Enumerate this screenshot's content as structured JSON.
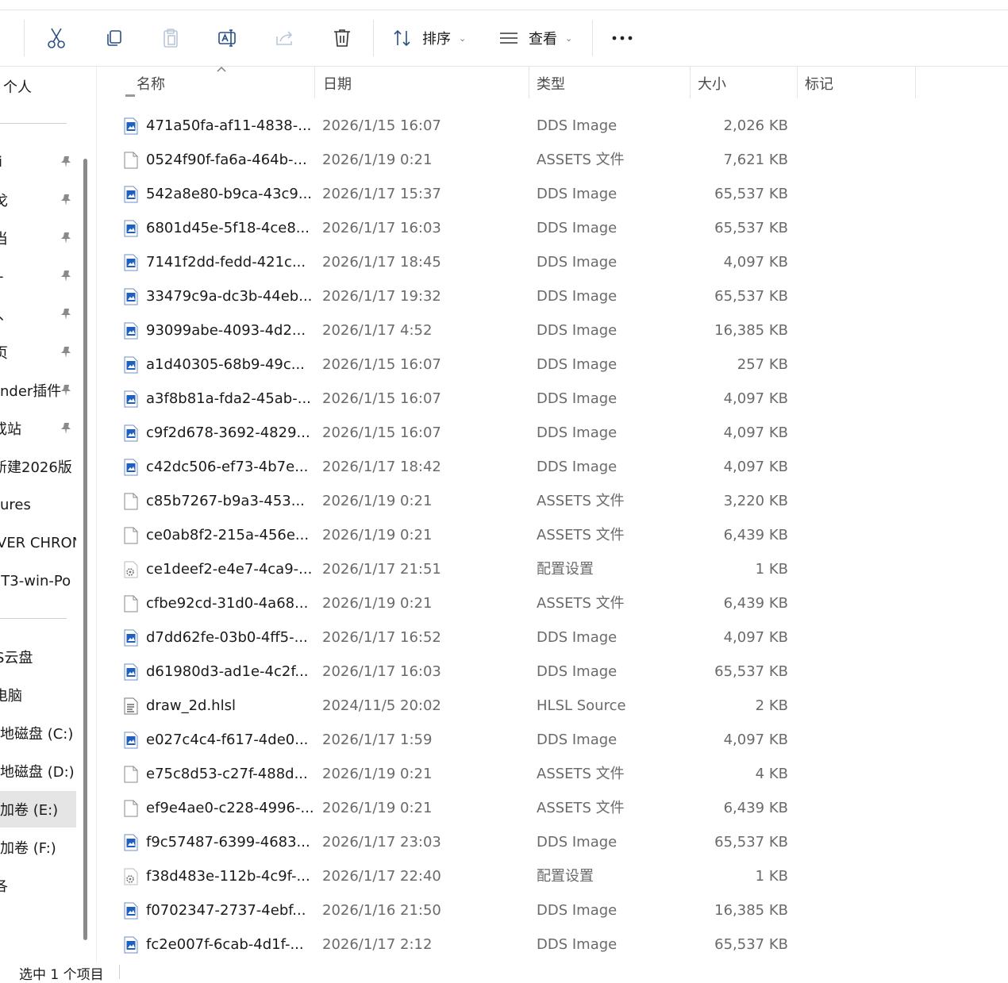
{
  "toolbar": {
    "sort_label": "排序",
    "view_label": "查看"
  },
  "sidebar": {
    "top_item": "个人",
    "pinned": [
      "i",
      "戈",
      "当",
      "-",
      "、",
      "页",
      "nder插件",
      "或站"
    ],
    "items": [
      "新建2026版",
      "ures",
      "VER CHRON",
      "IT3-win-Po"
    ],
    "drives": [
      "S云盘",
      "电脑",
      "地磁盘 (C:)",
      "地磁盘 (D:)",
      "加卷 (E:)",
      "加卷 (F:)",
      "各"
    ]
  },
  "columns": {
    "name": "名称",
    "date": "日期",
    "type": "类型",
    "size": "大小",
    "tags": "标记"
  },
  "files": [
    {
      "name": "471a50fa-af11-4838-...",
      "date": "2026/1/15 16:07",
      "type": "DDS Image",
      "size": "2,026 KB",
      "icon": "image"
    },
    {
      "name": "0524f90f-fa6a-464b-...",
      "date": "2026/1/19 0:21",
      "type": "ASSETS 文件",
      "size": "7,621 KB",
      "icon": "blank"
    },
    {
      "name": "542a8e80-b9ca-43c9...",
      "date": "2026/1/17 15:37",
      "type": "DDS Image",
      "size": "65,537 KB",
      "icon": "image"
    },
    {
      "name": "6801d45e-5f18-4ce8...",
      "date": "2026/1/17 16:03",
      "type": "DDS Image",
      "size": "65,537 KB",
      "icon": "image"
    },
    {
      "name": "7141f2dd-fedd-421c...",
      "date": "2026/1/17 18:45",
      "type": "DDS Image",
      "size": "4,097 KB",
      "icon": "image"
    },
    {
      "name": "33479c9a-dc3b-44eb...",
      "date": "2026/1/17 19:32",
      "type": "DDS Image",
      "size": "65,537 KB",
      "icon": "image"
    },
    {
      "name": "93099abe-4093-4d2...",
      "date": "2026/1/17 4:52",
      "type": "DDS Image",
      "size": "16,385 KB",
      "icon": "image"
    },
    {
      "name": "a1d40305-68b9-49c...",
      "date": "2026/1/15 16:07",
      "type": "DDS Image",
      "size": "257 KB",
      "icon": "image"
    },
    {
      "name": "a3f8b81a-fda2-45ab-...",
      "date": "2026/1/15 16:07",
      "type": "DDS Image",
      "size": "4,097 KB",
      "icon": "image"
    },
    {
      "name": "c9f2d678-3692-4829...",
      "date": "2026/1/15 16:07",
      "type": "DDS Image",
      "size": "4,097 KB",
      "icon": "image"
    },
    {
      "name": "c42dc506-ef73-4b7e...",
      "date": "2026/1/17 18:42",
      "type": "DDS Image",
      "size": "4,097 KB",
      "icon": "image"
    },
    {
      "name": "c85b7267-b9a3-453...",
      "date": "2026/1/19 0:21",
      "type": "ASSETS 文件",
      "size": "3,220 KB",
      "icon": "blank"
    },
    {
      "name": "ce0ab8f2-215a-456e...",
      "date": "2026/1/19 0:21",
      "type": "ASSETS 文件",
      "size": "6,439 KB",
      "icon": "blank"
    },
    {
      "name": "ce1deef2-e4e7-4ca9-...",
      "date": "2026/1/17 21:51",
      "type": "配置设置",
      "size": "1 KB",
      "icon": "config"
    },
    {
      "name": "cfbe92cd-31d0-4a68...",
      "date": "2026/1/19 0:21",
      "type": "ASSETS 文件",
      "size": "6,439 KB",
      "icon": "blank"
    },
    {
      "name": "d7dd62fe-03b0-4ff5-...",
      "date": "2026/1/17 16:52",
      "type": "DDS Image",
      "size": "4,097 KB",
      "icon": "image"
    },
    {
      "name": "d61980d3-ad1e-4c2f...",
      "date": "2026/1/17 16:03",
      "type": "DDS Image",
      "size": "65,537 KB",
      "icon": "image"
    },
    {
      "name": "draw_2d.hlsl",
      "date": "2024/11/5 20:02",
      "type": "HLSL Source",
      "size": "2 KB",
      "icon": "source"
    },
    {
      "name": "e027c4c4-f617-4de0...",
      "date": "2026/1/17 1:59",
      "type": "DDS Image",
      "size": "4,097 KB",
      "icon": "image"
    },
    {
      "name": "e75c8d53-c27f-488d...",
      "date": "2026/1/19 0:21",
      "type": "ASSETS 文件",
      "size": "4 KB",
      "icon": "blank"
    },
    {
      "name": "ef9e4ae0-c228-4996-...",
      "date": "2026/1/19 0:21",
      "type": "ASSETS 文件",
      "size": "6,439 KB",
      "icon": "blank"
    },
    {
      "name": "f9c57487-6399-4683...",
      "date": "2026/1/17 23:03",
      "type": "DDS Image",
      "size": "65,537 KB",
      "icon": "image"
    },
    {
      "name": "f38d483e-112b-4c9f-...",
      "date": "2026/1/17 22:40",
      "type": "配置设置",
      "size": "1 KB",
      "icon": "config"
    },
    {
      "name": "f0702347-2737-4ebf...",
      "date": "2026/1/16 21:50",
      "type": "DDS Image",
      "size": "16,385 KB",
      "icon": "image"
    },
    {
      "name": "fc2e007f-6cab-4d1f-...",
      "date": "2026/1/17 2:12",
      "type": "DDS Image",
      "size": "65,537 KB",
      "icon": "image"
    }
  ],
  "status": {
    "selection": "选中 1 个项目"
  },
  "colors": {
    "accent": "#1f5fbf",
    "selected_nav": "#e5e5e5"
  }
}
